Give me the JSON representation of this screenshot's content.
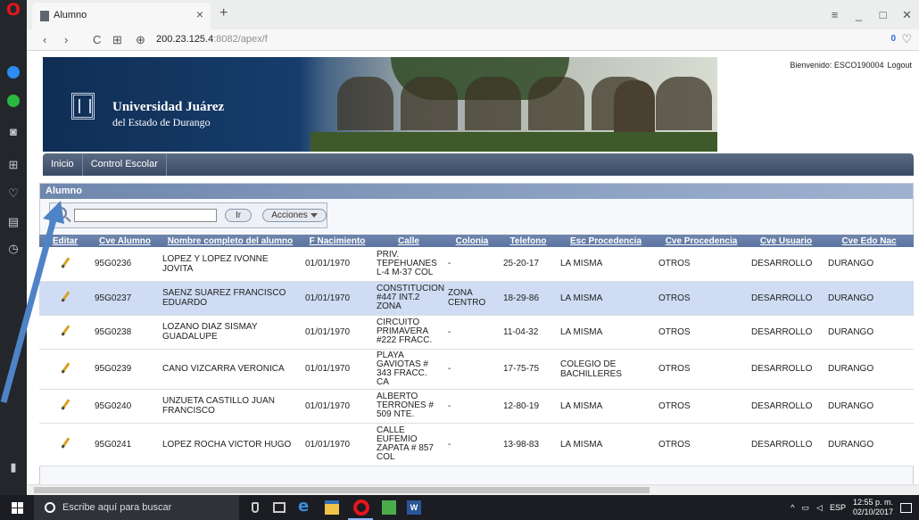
{
  "browser": {
    "tab_title": "Alumno",
    "tab_close": "×",
    "new_tab": "+",
    "address_host": "200.23.125.4",
    "address_rest": ":8082/apex/f",
    "vpn_badge": "0",
    "controls": {
      "menu": "≡",
      "minimize": "_",
      "maximize": "□",
      "close": "✕"
    },
    "nav": {
      "back": "‹",
      "forward": "›",
      "reload": "C",
      "grid": "⊞",
      "site_info": "⊕"
    }
  },
  "banner": {
    "brand_line1": "Universidad Juárez",
    "brand_line2": "del Estado de Durango",
    "welcome": "Bienvenido: ESCO190004",
    "logout": "Logout"
  },
  "nav": {
    "tabs": [
      "Inicio",
      "Control Escolar"
    ]
  },
  "region": {
    "title": "Alumno",
    "search_value": "",
    "go_label": "Ir",
    "actions_label": "Acciones"
  },
  "table": {
    "columns": [
      "Editar",
      "Cve Alumno",
      "Nombre completo del alumno",
      "F Nacimiento",
      "Calle",
      "Colonia",
      "Telefono",
      "Esc Procedencia",
      "Cve Procedencia",
      "Cve Usuario",
      "Cve Edo Nac"
    ],
    "rows": [
      {
        "cve": "95G0236",
        "nombre": "LOPEZ Y LOPEZ IVONNE JOVITA",
        "fnac": "01/01/1970",
        "calle": "PRIV. TEPEHUANES L-4 M-37 COL",
        "colonia": "-",
        "tel": "25-20-17",
        "esc": "LA MISMA",
        "cveproc": "OTROS",
        "usuario": "DESARROLLO",
        "edo": "DURANGO"
      },
      {
        "cve": "95G0237",
        "nombre": "SAENZ SUAREZ FRANCISCO EDUARDO",
        "fnac": "01/01/1970",
        "calle": "CONSTITUCION #447 INT.2 ZONA",
        "colonia": "ZONA CENTRO",
        "tel": "18-29-86",
        "esc": "LA MISMA",
        "cveproc": "OTROS",
        "usuario": "DESARROLLO",
        "edo": "DURANGO"
      },
      {
        "cve": "95G0238",
        "nombre": "LOZANO DIAZ SISMAY GUADALUPE",
        "fnac": "01/01/1970",
        "calle": "CIRCUITO PRIMAVERA #222 FRACC.",
        "colonia": "-",
        "tel": "11-04-32",
        "esc": "LA MISMA",
        "cveproc": "OTROS",
        "usuario": "DESARROLLO",
        "edo": "DURANGO"
      },
      {
        "cve": "95G0239",
        "nombre": "CANO VIZCARRA VERONICA",
        "fnac": "01/01/1970",
        "calle": "PLAYA GAVIOTAS # 343 FRACC. CA",
        "colonia": "-",
        "tel": "17-75-75",
        "esc": "COLEGIO DE BACHILLERES",
        "cveproc": "OTROS",
        "usuario": "DESARROLLO",
        "edo": "DURANGO"
      },
      {
        "cve": "95G0240",
        "nombre": "UNZUETA CASTILLO JUAN FRANCISCO",
        "fnac": "01/01/1970",
        "calle": "ALBERTO TERRONES # 509 NTE.",
        "colonia": "-",
        "tel": "12-80-19",
        "esc": "LA MISMA",
        "cveproc": "OTROS",
        "usuario": "DESARROLLO",
        "edo": "DURANGO"
      },
      {
        "cve": "95G0241",
        "nombre": "LOPEZ ROCHA VICTOR HUGO",
        "fnac": "01/01/1970",
        "calle": "CALLE EUFEMIO ZAPATA # 857 COL",
        "colonia": "-",
        "tel": "13-98-83",
        "esc": "LA MISMA",
        "cveproc": "OTROS",
        "usuario": "DESARROLLO",
        "edo": "DURANGO"
      }
    ]
  },
  "taskbar": {
    "search_placeholder": "Escribe aquí para buscar",
    "lang": "ESP",
    "time": "12:55 p. m.",
    "date": "02/10/2017",
    "word_label": "W"
  }
}
